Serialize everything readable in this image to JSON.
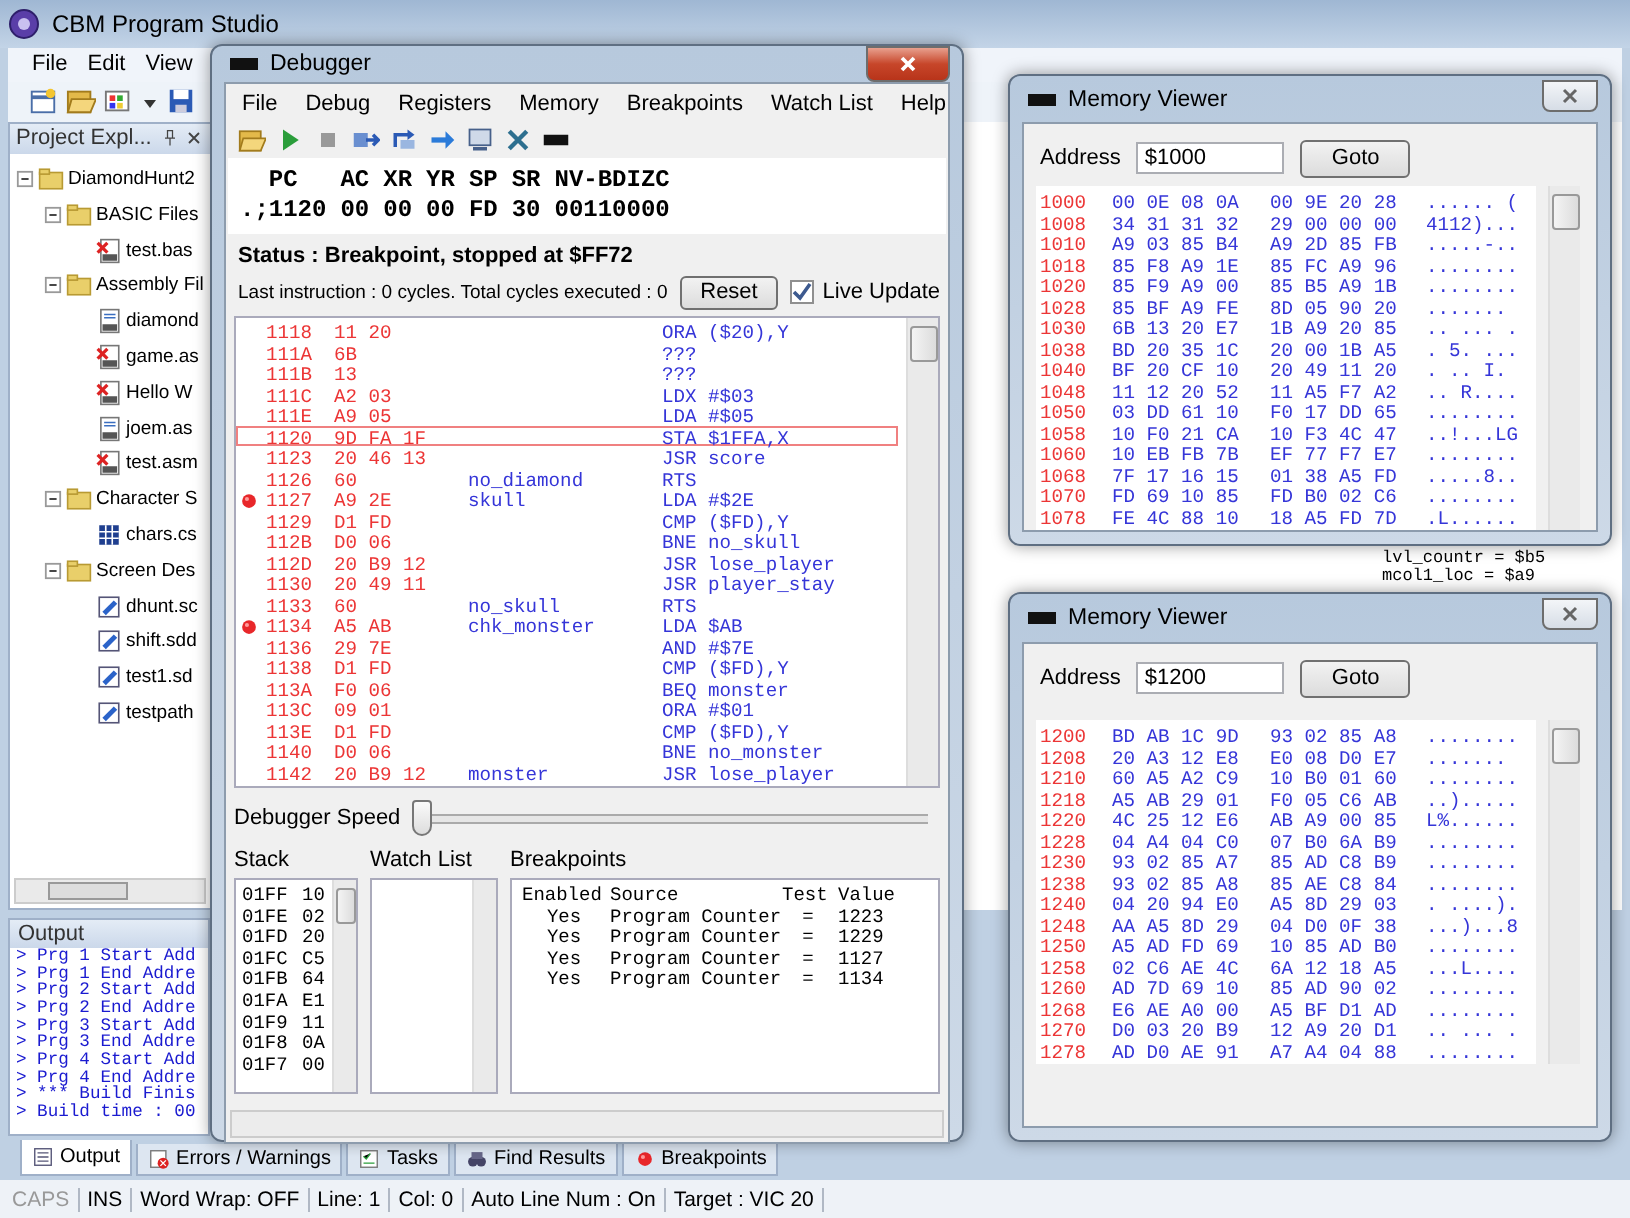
{
  "app": {
    "title": "CBM Program Studio",
    "menu": [
      "File",
      "Edit",
      "View"
    ],
    "project_explorer": {
      "title": "Project Expl...",
      "tree": [
        {
          "label": "DiamondHunt2",
          "kind": "folder",
          "expanded": true,
          "children": [
            {
              "label": "BASIC Files",
              "kind": "folder",
              "expanded": true,
              "children": [
                {
                  "label": "test.bas",
                  "kind": "file",
                  "error": true
                }
              ]
            },
            {
              "label": "Assembly Fil",
              "kind": "folder",
              "expanded": true,
              "children": [
                {
                  "label": "diamond",
                  "kind": "file",
                  "error": false
                },
                {
                  "label": "game.as",
                  "kind": "file",
                  "error": true
                },
                {
                  "label": "Hello W",
                  "kind": "file",
                  "error": true
                },
                {
                  "label": "joem.as",
                  "kind": "file",
                  "error": false
                },
                {
                  "label": "test.asm",
                  "kind": "file",
                  "error": true
                }
              ]
            },
            {
              "label": "Character S",
              "kind": "folder",
              "expanded": true,
              "children": [
                {
                  "label": "chars.cs",
                  "kind": "charset"
                }
              ]
            },
            {
              "label": "Screen Des",
              "kind": "folder",
              "expanded": true,
              "children": [
                {
                  "label": "dhunt.sc",
                  "kind": "screen"
                },
                {
                  "label": "shift.sdd",
                  "kind": "screen"
                },
                {
                  "label": "test1.sd",
                  "kind": "screen"
                },
                {
                  "label": "testpath",
                  "kind": "screen"
                }
              ]
            }
          ]
        }
      ]
    },
    "editor": {
      "lines": [
        "lvl_countr = $b5",
        "mcol1_loc = $a9"
      ]
    },
    "output": {
      "title": "Output",
      "lines": [
        "> Prg 1 Start Add",
        "> Prg 1 End Addre",
        "> Prg 2 Start Add",
        "> Prg 2 End Addre",
        "> Prg 3 Start Add",
        "> Prg 3 End Addre",
        "> Prg 4 Start Add",
        "> Prg 4 End Addre",
        "> *** Build Finis",
        "> Build time : 00"
      ]
    },
    "bottom_tabs": [
      {
        "label": "Output",
        "selected": true
      },
      {
        "label": "Errors / Warnings",
        "selected": false
      },
      {
        "label": "Tasks",
        "selected": false
      },
      {
        "label": "Find Results",
        "selected": false
      },
      {
        "label": "Breakpoints",
        "selected": false
      }
    ],
    "status_bar": [
      {
        "text": "CAPS",
        "active": false
      },
      {
        "text": "INS",
        "active": true
      },
      {
        "text": "Word Wrap: OFF",
        "active": true
      },
      {
        "text": "Line: 1",
        "active": true
      },
      {
        "text": "Col: 0",
        "active": true
      },
      {
        "text": "Auto Line Num : On",
        "active": true
      },
      {
        "text": "Target : VIC 20",
        "active": true
      }
    ]
  },
  "debugger": {
    "title": "Debugger",
    "menu": [
      "File",
      "Debug",
      "Registers",
      "Memory",
      "Breakpoints",
      "Watch List",
      "Help"
    ],
    "registers": {
      "names": [
        "PC",
        "AC",
        "XR",
        "YR",
        "SP",
        "SR",
        "NV-BDIZC"
      ],
      "values": [
        ".;1120",
        "00",
        "00",
        "00",
        "FD",
        "30",
        "00110000"
      ]
    },
    "status": "Status : Breakpoint, stopped at $FF72",
    "last_instruction": "Last instruction : 0 cycles. Total cycles executed : 0",
    "reset_button": "Reset",
    "live_update": {
      "label": "Live Update",
      "checked": true
    },
    "code": [
      {
        "address": "1118",
        "bytes": "11 20",
        "instruction": "ORA ($20),Y",
        "breakpoint": false,
        "selected": false
      },
      {
        "address": "111A",
        "bytes": "6B",
        "instruction": "???",
        "breakpoint": false,
        "selected": false
      },
      {
        "address": "111B",
        "bytes": "13",
        "instruction": "???",
        "breakpoint": false,
        "selected": false
      },
      {
        "address": "111C",
        "bytes": "A2 03",
        "instruction": "LDX #$03",
        "breakpoint": false,
        "selected": false
      },
      {
        "address": "111E",
        "bytes": "A9 05",
        "instruction": "LDA #$05",
        "breakpoint": false,
        "selected": false
      },
      {
        "address": "1120",
        "bytes": "9D FA 1F",
        "instruction": "STA $1FFA,X",
        "breakpoint": false,
        "selected": true
      },
      {
        "address": "1123",
        "bytes": "20 46 13",
        "instruction": "JSR score",
        "breakpoint": false,
        "selected": false
      },
      {
        "address": "1126",
        "bytes": "60",
        "label": "no_diamond",
        "instruction": "RTS",
        "breakpoint": false,
        "selected": false
      },
      {
        "address": "1127",
        "bytes": "A9 2E",
        "label": "skull",
        "instruction": "LDA #$2E",
        "breakpoint": true,
        "selected": false
      },
      {
        "address": "1129",
        "bytes": "D1 FD",
        "instruction": "CMP ($FD),Y",
        "breakpoint": false,
        "selected": false
      },
      {
        "address": "112B",
        "bytes": "D0 06",
        "instruction": "BNE no_skull",
        "breakpoint": false,
        "selected": false
      },
      {
        "address": "112D",
        "bytes": "20 B9 12",
        "instruction": "JSR lose_player",
        "breakpoint": false,
        "selected": false
      },
      {
        "address": "1130",
        "bytes": "20 49 11",
        "instruction": "JSR player_stay",
        "breakpoint": false,
        "selected": false
      },
      {
        "address": "1133",
        "bytes": "60",
        "label": "no_skull",
        "instruction": "RTS",
        "breakpoint": false,
        "selected": false
      },
      {
        "address": "1134",
        "bytes": "A5 AB",
        "label": "chk_monster",
        "instruction": "LDA $AB",
        "breakpoint": true,
        "selected": false
      },
      {
        "address": "1136",
        "bytes": "29 7E",
        "instruction": "AND #$7E",
        "breakpoint": false,
        "selected": false
      },
      {
        "address": "1138",
        "bytes": "D1 FD",
        "instruction": "CMP ($FD),Y",
        "breakpoint": false,
        "selected": false
      },
      {
        "address": "113A",
        "bytes": "F0 06",
        "instruction": "BEQ monster",
        "breakpoint": false,
        "selected": false
      },
      {
        "address": "113C",
        "bytes": "09 01",
        "instruction": "ORA #$01",
        "breakpoint": false,
        "selected": false
      },
      {
        "address": "113E",
        "bytes": "D1 FD",
        "instruction": "CMP ($FD),Y",
        "breakpoint": false,
        "selected": false
      },
      {
        "address": "1140",
        "bytes": "D0 06",
        "instruction": "BNE no_monster",
        "breakpoint": false,
        "selected": false
      },
      {
        "address": "1142",
        "bytes": "20 B9 12",
        "label": "monster",
        "instruction": "JSR lose_player",
        "breakpoint": false,
        "selected": false
      }
    ],
    "speed": {
      "label": "Debugger Speed",
      "level": 0
    },
    "stack": {
      "title": "Stack",
      "rows": [
        {
          "address": "01FF",
          "value": "10"
        },
        {
          "address": "01FE",
          "value": "02"
        },
        {
          "address": "01FD",
          "value": "20"
        },
        {
          "address": "01FC",
          "value": "C5"
        },
        {
          "address": "01FB",
          "value": "64"
        },
        {
          "address": "01FA",
          "value": "E1"
        },
        {
          "address": "01F9",
          "value": "11"
        },
        {
          "address": "01F8",
          "value": "0A"
        },
        {
          "address": "01F7",
          "value": "00"
        }
      ]
    },
    "watch_list": {
      "title": "Watch List"
    },
    "breakpoints": {
      "title": "Breakpoints",
      "columns": [
        "Enabled",
        "Source",
        "Test",
        "Value"
      ],
      "rows": [
        {
          "enabled": "Yes",
          "source": "Program Counter",
          "test": "=",
          "value": "1223"
        },
        {
          "enabled": "Yes",
          "source": "Program Counter",
          "test": "=",
          "value": "1229"
        },
        {
          "enabled": "Yes",
          "source": "Program Counter",
          "test": "=",
          "value": "1127"
        },
        {
          "enabled": "Yes",
          "source": "Program Counter",
          "test": "=",
          "value": "1134"
        }
      ]
    }
  },
  "memory_viewers": [
    {
      "title": "Memory Viewer",
      "address_label": "Address",
      "address": "$1000",
      "goto_button": "Goto",
      "rows": [
        {
          "address": "1000",
          "bytes": [
            "00 0E 08 0A",
            "00 9E 20 28"
          ],
          "ascii": "...... ("
        },
        {
          "address": "1008",
          "bytes": [
            "34 31 31 32",
            "29 00 00 00"
          ],
          "ascii": "4112)..."
        },
        {
          "address": "1010",
          "bytes": [
            "A9 03 85 B4",
            "A9 2D 85 FB"
          ],
          "ascii": ".....-.."
        },
        {
          "address": "1018",
          "bytes": [
            "85 F8 A9 1E",
            "85 FC A9 96"
          ],
          "ascii": "........"
        },
        {
          "address": "1020",
          "bytes": [
            "85 F9 A9 00",
            "85 B5 A9 1B"
          ],
          "ascii": "........"
        },
        {
          "address": "1028",
          "bytes": [
            "85 BF A9 FE",
            "8D 05 90 20"
          ],
          "ascii": "......."
        },
        {
          "address": "1030",
          "bytes": [
            "6B 13 20 E7",
            "1B A9 20 85"
          ],
          "ascii": ".. ... ."
        },
        {
          "address": "1038",
          "bytes": [
            "BD 20 35 1C",
            "20 00 1B A5"
          ],
          "ascii": ". 5. ..."
        },
        {
          "address": "1040",
          "bytes": [
            "BF 20 CF 10",
            "20 49 11 20"
          ],
          "ascii": ". .. I."
        },
        {
          "address": "1048",
          "bytes": [
            "11 12 20 52",
            "11 A5 F7 A2"
          ],
          "ascii": ".. R...."
        },
        {
          "address": "1050",
          "bytes": [
            "03 DD 61 10",
            "F0 17 DD 65"
          ],
          "ascii": "........"
        },
        {
          "address": "1058",
          "bytes": [
            "10 F0 21 CA",
            "10 F3 4C 47"
          ],
          "ascii": "..!...LG"
        },
        {
          "address": "1060",
          "bytes": [
            "10 EB FB 7B",
            "EF 77 F7 E7"
          ],
          "ascii": "........"
        },
        {
          "address": "1068",
          "bytes": [
            "7F 17 16 15",
            "01 38 A5 FD"
          ],
          "ascii": ".....8.."
        },
        {
          "address": "1070",
          "bytes": [
            "FD 69 10 85",
            "FD B0 02 C6"
          ],
          "ascii": "........"
        },
        {
          "address": "1078",
          "bytes": [
            "FE 4C 88 10",
            "18 A5 FD 7D"
          ],
          "ascii": ".L......"
        }
      ]
    },
    {
      "title": "Memory Viewer",
      "address_label": "Address",
      "address": "$1200",
      "goto_button": "Goto",
      "rows": [
        {
          "address": "1200",
          "bytes": [
            "BD AB 1C 9D",
            "93 02 85 A8"
          ],
          "ascii": "........"
        },
        {
          "address": "1208",
          "bytes": [
            "20 A3 12 E8",
            "E0 08 D0 E7"
          ],
          "ascii": "......."
        },
        {
          "address": "1210",
          "bytes": [
            "60 A5 A2 C9",
            "10 B0 01 60"
          ],
          "ascii": "........"
        },
        {
          "address": "1218",
          "bytes": [
            "A5 AB 29 01",
            "F0 05 C6 AB"
          ],
          "ascii": "..)....."
        },
        {
          "address": "1220",
          "bytes": [
            "4C 25 12 E6",
            "AB A9 00 85"
          ],
          "ascii": "L%......"
        },
        {
          "address": "1228",
          "bytes": [
            "04 A4 04 C0",
            "07 B0 6A B9"
          ],
          "ascii": "........"
        },
        {
          "address": "1230",
          "bytes": [
            "93 02 85 A7",
            "85 AD C8 B9"
          ],
          "ascii": "........"
        },
        {
          "address": "1238",
          "bytes": [
            "93 02 85 A8",
            "85 AE C8 84"
          ],
          "ascii": "........"
        },
        {
          "address": "1240",
          "bytes": [
            "04 20 94 E0",
            "A5 8D 29 03"
          ],
          "ascii": ". ....)."
        },
        {
          "address": "1248",
          "bytes": [
            "AA A5 8D 29",
            "04 D0 0F 38"
          ],
          "ascii": "...)...8"
        },
        {
          "address": "1250",
          "bytes": [
            "A5 AD FD 69",
            "10 85 AD B0"
          ],
          "ascii": "........"
        },
        {
          "address": "1258",
          "bytes": [
            "02 C6 AE 4C",
            "6A 12 18 A5"
          ],
          "ascii": "...L...."
        },
        {
          "address": "1260",
          "bytes": [
            "AD 7D 69 10",
            "85 AD 90 02"
          ],
          "ascii": "........"
        },
        {
          "address": "1268",
          "bytes": [
            "E6 AE A0 00",
            "A5 BF D1 AD"
          ],
          "ascii": "........"
        },
        {
          "address": "1270",
          "bytes": [
            "D0 03 20 B9",
            "12 A9 20 D1"
          ],
          "ascii": ".. ... ."
        },
        {
          "address": "1278",
          "bytes": [
            "AD D0 AE 91",
            "A7 A4 04 88"
          ],
          "ascii": "........"
        }
      ]
    }
  ]
}
